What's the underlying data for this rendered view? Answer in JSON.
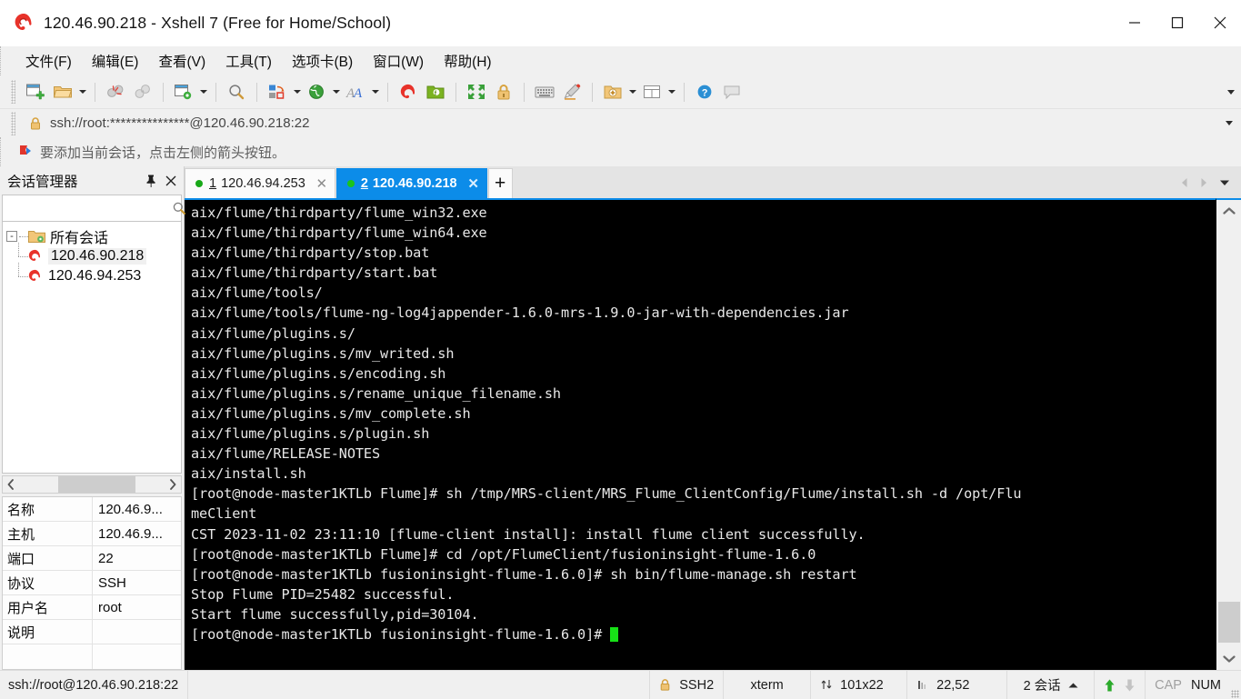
{
  "window": {
    "title": "120.46.90.218 - Xshell 7 (Free for Home/School)",
    "app_icon": "xshell-logo-icon",
    "minimize_label": "—",
    "maximize_label": "□",
    "close_label": "✕"
  },
  "menubar": {
    "items": [
      {
        "label": "文件(F)",
        "name": "menu-file"
      },
      {
        "label": "编辑(E)",
        "name": "menu-edit"
      },
      {
        "label": "查看(V)",
        "name": "menu-view"
      },
      {
        "label": "工具(T)",
        "name": "menu-tools"
      },
      {
        "label": "选项卡(B)",
        "name": "menu-tabs"
      },
      {
        "label": "窗口(W)",
        "name": "menu-window"
      },
      {
        "label": "帮助(H)",
        "name": "menu-help"
      }
    ]
  },
  "toolbar": {
    "buttons": [
      "new-session-icon",
      "open-folder-icon",
      "disconnect-icon",
      "reconnect-icon",
      "session-properties-icon",
      "find-icon",
      "transfer-file-icon",
      "web-browser-icon",
      "font-icon",
      "xshell-icon",
      "xftp-icon",
      "fullscreen-icon",
      "lock-icon",
      "keyboard-icon",
      "highlight-icon",
      "add-to-folder-icon",
      "layout-icon",
      "help-icon",
      "chat-icon"
    ],
    "overflow_label": "▼"
  },
  "address": {
    "lock_icon": "lock-icon",
    "value": "ssh://root:***************@120.46.90.218:22",
    "dropdown_label": "▼"
  },
  "notification": {
    "icon": "red-arrow-flag-icon",
    "text": "要添加当前会话，点击左侧的箭头按钮。"
  },
  "sidebar": {
    "title": "会话管理器",
    "pin_label": "📌",
    "close_label": "✕",
    "search": {
      "value": "",
      "placeholder": "",
      "icon": "search-icon"
    },
    "tree": {
      "root_label": "所有会话",
      "root_expander": "-",
      "children": [
        {
          "label": "120.46.90.218",
          "selected": true
        },
        {
          "label": "120.46.94.253",
          "selected": false
        }
      ]
    },
    "hscroll": {
      "left_label": "‹",
      "right_label": "›"
    },
    "properties": [
      {
        "key": "名称",
        "value": "120.46.9..."
      },
      {
        "key": "主机",
        "value": "120.46.9..."
      },
      {
        "key": "端口",
        "value": "22"
      },
      {
        "key": "协议",
        "value": "SSH"
      },
      {
        "key": "用户名",
        "value": "root"
      },
      {
        "key": "说明",
        "value": ""
      },
      {
        "key": "",
        "value": ""
      }
    ]
  },
  "tabs": {
    "items": [
      {
        "num": "1",
        "label": "120.46.94.253",
        "active": false,
        "close_label": "✕",
        "status": "connected"
      },
      {
        "num": "2",
        "label": "120.46.90.218",
        "active": true,
        "close_label": "✕",
        "status": "connected"
      }
    ],
    "add_label": "+",
    "nav_prev": "◀",
    "nav_next": "▶",
    "nav_menu": "▼"
  },
  "terminal": {
    "lines": [
      "aix/flume/thirdparty/flume_win32.exe",
      "aix/flume/thirdparty/flume_win64.exe",
      "aix/flume/thirdparty/stop.bat",
      "aix/flume/thirdparty/start.bat",
      "aix/flume/tools/",
      "aix/flume/tools/flume-ng-log4jappender-1.6.0-mrs-1.9.0-jar-with-dependencies.jar",
      "aix/flume/plugins.s/",
      "aix/flume/plugins.s/mv_writed.sh",
      "aix/flume/plugins.s/encoding.sh",
      "aix/flume/plugins.s/rename_unique_filename.sh",
      "aix/flume/plugins.s/mv_complete.sh",
      "aix/flume/plugins.s/plugin.sh",
      "aix/flume/RELEASE-NOTES",
      "aix/install.sh",
      "[root@node-master1KTLb Flume]# sh /tmp/MRS-client/MRS_Flume_ClientConfig/Flume/install.sh -d /opt/Flu",
      "meClient",
      "CST 2023-11-02 23:11:10 [flume-client install]: install flume client successfully.",
      "[root@node-master1KTLb Flume]# cd /opt/FlumeClient/fusioninsight-flume-1.6.0",
      "[root@node-master1KTLb fusioninsight-flume-1.6.0]# sh bin/flume-manage.sh restart",
      "Stop Flume PID=25482 successful.",
      "Start flume successfully,pid=30104.",
      "[root@node-master1KTLb fusioninsight-flume-1.6.0]# "
    ],
    "cursor_visible": true,
    "scroll_up_label": "︿",
    "scroll_down_label": "﹀"
  },
  "statusbar": {
    "connection": "ssh://root@120.46.90.218:22",
    "security_icon": "lock-icon",
    "security": "SSH2",
    "terminal_type": "xterm",
    "size_icon": "resize-arrows-icon",
    "size": "101x22",
    "cursor_icon": "cursor-pos-icon",
    "cursor_pos": "22,52",
    "sessions": "2 会话",
    "sessions_caret": "▲",
    "upload_icon": "arrow-up-icon",
    "download_icon": "arrow-down-icon",
    "cap": "CAP",
    "num": "NUM"
  },
  "colors": {
    "accent": "#0c8ce9",
    "terminal_bg": "#000000",
    "terminal_fg": "#e8e8e8",
    "cursor_green": "#17e017",
    "chrome_bg": "#f0f0f0",
    "status_green": "#18a818"
  }
}
